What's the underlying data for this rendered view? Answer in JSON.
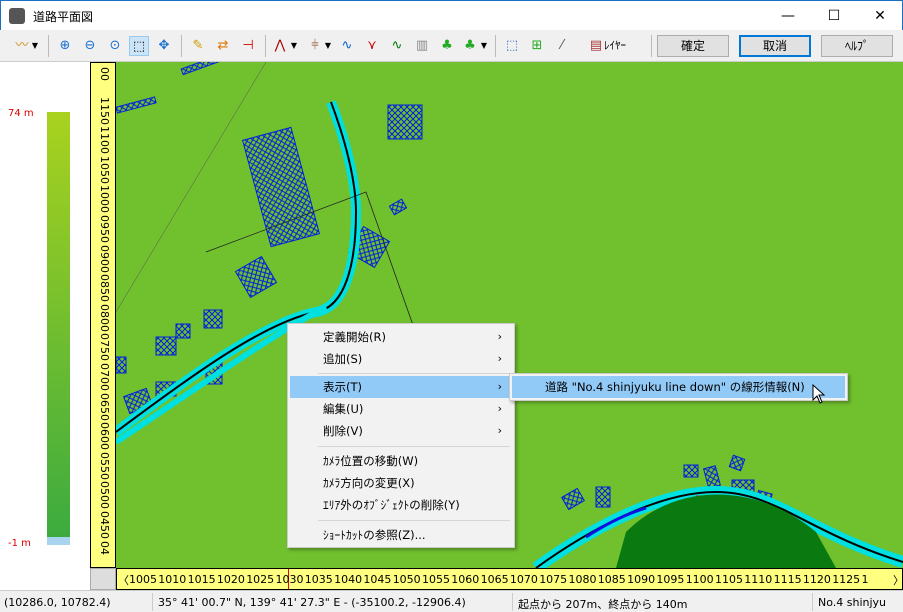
{
  "window": {
    "title": "道路平面図",
    "minimize": "—",
    "maximize": "☐",
    "close": "✕"
  },
  "toolbar": {
    "icons": [
      "terrain-icon",
      "zoom-in-icon",
      "zoom-out-icon",
      "zoom-fit-icon",
      "zoom-window-icon",
      "pan-icon",
      "edit-icon",
      "swap-icon",
      "measure-icon",
      "road-line-icon",
      "bridge-icon",
      "curve-icon",
      "branch-icon",
      "alignment-icon",
      "building-icon",
      "tree-icon",
      "forest-icon",
      "select-rect-icon",
      "add-object-icon",
      "cut-icon",
      "layer-icon"
    ],
    "layer_label": "ﾚｲﾔｰ",
    "confirm": "確定",
    "cancel": "取消",
    "help": "ﾍﾙﾌﾟ"
  },
  "legend": {
    "max": "74 m",
    "min": "-1 m",
    "colors": {
      "top": "#a9d21f",
      "bottom": "#3cab3f"
    }
  },
  "vruler": {
    "labels": [
      "00",
      "1150",
      "1100",
      "1050",
      "1000",
      "0950",
      "0900",
      "0850",
      "0800",
      "0750",
      "0700",
      "0650",
      "0600",
      "0550",
      "0500",
      "0450",
      "04"
    ]
  },
  "hruler": {
    "labels": [
      "1005",
      "1010",
      "1015",
      "1020",
      "1025",
      "1030",
      "1035",
      "1040",
      "1045",
      "1050",
      "1055",
      "1060",
      "1065",
      "1070",
      "1075",
      "1080",
      "1085",
      "1090",
      "1095",
      "1100",
      "1105",
      "1110",
      "1115",
      "1120",
      "1125",
      "1"
    ],
    "left_arrow": "〈",
    "right_arrow": "〉"
  },
  "context_menu": {
    "items": [
      {
        "label": "定義開始(R)",
        "submenu": true
      },
      {
        "label": "追加(S)",
        "submenu": true
      },
      {
        "label": "表示(T)",
        "submenu": true,
        "highlighted": true
      },
      {
        "label": "編集(U)",
        "submenu": true
      },
      {
        "label": "削除(V)",
        "submenu": true
      },
      {
        "label": "ｶﾒﾗ位置の移動(W)"
      },
      {
        "label": "ｶﾒﾗ方向の変更(X)"
      },
      {
        "label": "ｴﾘｱ外のｵﾌﾞｼﾞｪｸﾄの削除(Y)"
      },
      {
        "label": "ｼｮｰﾄｶｯﾄの参照(Z)..."
      }
    ],
    "arrow": "›",
    "submenu_item": "道路 \"No.4 shinjyuku line down\" の線形情報(N)"
  },
  "status": {
    "coords": "(10286.0, 10782.4)",
    "latlon": "35° 41' 00.7\" N, 139° 41' 27.3\" E  -  (-35100.2, -12906.4)",
    "distance": "起点から 207m、終点から 140m",
    "road": "No.4 shinjyu"
  },
  "colors": {
    "map_bg": "#72c02c",
    "highlight": "#91c9f7",
    "ruler": "#ffff80"
  }
}
